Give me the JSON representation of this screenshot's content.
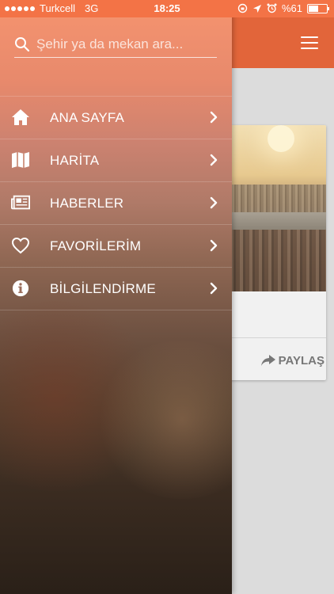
{
  "status_bar": {
    "carrier": "Turkcell",
    "network": "3G",
    "time": "18:25",
    "battery": "%61",
    "battery_level": 0.61
  },
  "search": {
    "placeholder": "Şehir ya da mekan ara..."
  },
  "menu": {
    "items": [
      {
        "label": "ANA SAYFA",
        "icon": "home-icon"
      },
      {
        "label": "HARİTA",
        "icon": "map-icon"
      },
      {
        "label": "HABERLER",
        "icon": "news-icon"
      },
      {
        "label": "FAVORİLERİM",
        "icon": "heart-icon"
      },
      {
        "label": "BİLGİLENDİRME",
        "icon": "info-icon"
      }
    ]
  },
  "card": {
    "share_label": "PAYLAŞ"
  },
  "colors": {
    "accent": "#f37346",
    "header": "#e2653a"
  }
}
